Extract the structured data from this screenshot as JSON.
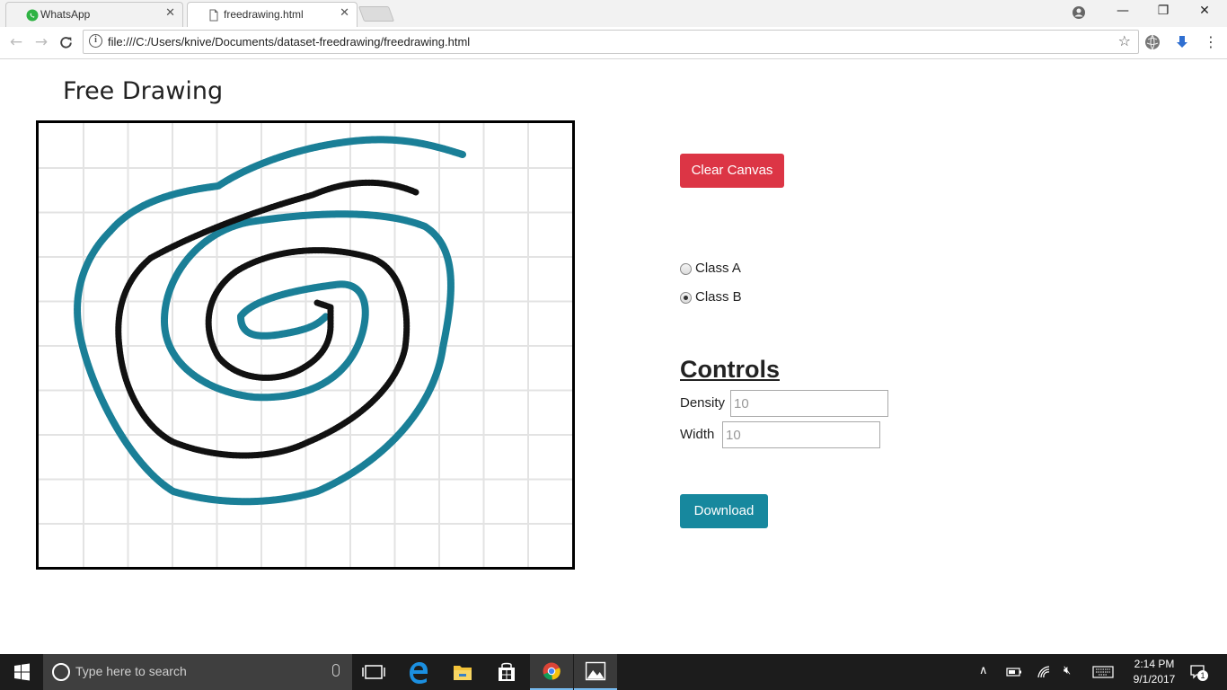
{
  "browser": {
    "tabs": [
      {
        "title": "WhatsApp",
        "close": "✕",
        "active": false
      },
      {
        "title": "freedrawing.html",
        "close": "✕",
        "active": true
      }
    ],
    "url": "file:///C:/Users/knive/Documents/dataset-freedrawing/freedrawing.html",
    "window_controls": {
      "minimize": "—",
      "restore": "❐",
      "close": "✕"
    }
  },
  "page": {
    "title": "Free Drawing",
    "clear_label": "Clear Canvas",
    "class_options": [
      {
        "label": "Class A",
        "checked": false
      },
      {
        "label": "Class B",
        "checked": true
      }
    ],
    "controls_heading": "Controls",
    "density_label": "Density",
    "density_placeholder": "10",
    "width_label": "Width",
    "width_placeholder": "10",
    "download_label": "Download",
    "colors": {
      "clear_button": "#dc3545",
      "download_button": "#17889e",
      "stroke_teal": "#1a7f97",
      "stroke_black": "#111111"
    }
  },
  "taskbar": {
    "search_placeholder": "Type here to search",
    "time": "2:14 PM",
    "date": "9/1/2017",
    "notification_count": "1"
  }
}
